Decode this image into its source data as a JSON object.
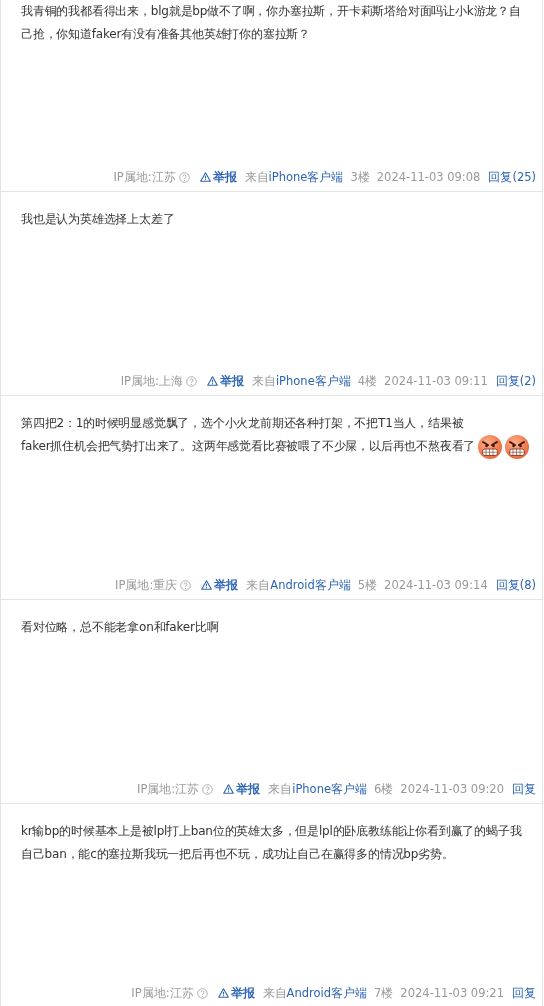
{
  "posts": [
    {
      "text": "我青铜的我都看得出来，blg就是bp做不了啊，你办塞拉斯，开卡莉斯塔给对面吗让小k游龙？自己抢，你知道faker有没有准备其他英雄打你的塞拉斯？",
      "footer": {
        "ip_location": "IP属地:江苏",
        "report": "举报",
        "source_prefix": "来自",
        "client": "iPhone客户端",
        "floor": "3楼",
        "time": "2024-11-03 09:08",
        "reply": "回复(25)"
      }
    },
    {
      "text": "我也是认为英雄选择上太差了",
      "footer": {
        "ip_location": "IP属地:上海",
        "report": "举报",
        "source_prefix": "来自",
        "client": "iPhone客户端",
        "floor": "4楼",
        "time": "2024-11-03 09:11",
        "reply": "回复(2)"
      }
    },
    {
      "text": "第四把2：1的时候明显感觉飘了，选个小火龙前期还各种打架，不把T1当人，结果被faker抓住机会把气势打出来了。这两年感觉看比赛被喂了不少屎，以后再也不熬夜看了",
      "emojis": [
        {
          "kind": "angry"
        },
        {
          "kind": "angry"
        }
      ],
      "footer": {
        "ip_location": "IP属地:重庆",
        "report": "举报",
        "source_prefix": "来自",
        "client": "Android客户端",
        "floor": "5楼",
        "time": "2024-11-03 09:14",
        "reply": "回复(8)"
      }
    },
    {
      "text": "看对位略，总不能老拿on和faker比啊",
      "footer": {
        "ip_location": "IP属地:江苏",
        "report": "举报",
        "source_prefix": "来自",
        "client": "iPhone客户端",
        "floor": "6楼",
        "time": "2024-11-03 09:20",
        "reply": "回复"
      }
    },
    {
      "text": "kr输bp的时候基本上是被lpl打上ban位的英雄太多，但是lpl的卧底教练能让你看到赢了的蝎子我自己ban，能c的塞拉斯我玩一把后再也不玩，成功让自己在赢得多的情况bp劣势。",
      "footer": {
        "ip_location": "IP属地:江苏",
        "report": "举报",
        "source_prefix": "来自",
        "client": "Android客户端",
        "floor": "7楼",
        "time": "2024-11-03 09:21",
        "reply": "回复"
      }
    }
  ]
}
